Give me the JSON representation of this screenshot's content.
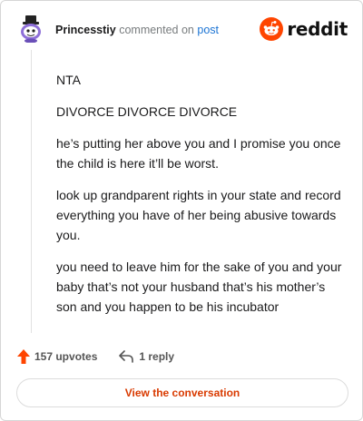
{
  "header": {
    "username": "Princesstiy",
    "commented_text": "commented on",
    "post_link": "post",
    "brand": "reddit",
    "avatar_icon": "snoo-avatar-icon",
    "brand_icon": "reddit-logo-icon",
    "brand_color": "#ff4500"
  },
  "comment": {
    "paragraphs": [
      "NTA",
      "DIVORCE DIVORCE DIVORCE",
      "he’s putting her above you and I promise you once the child is here it’ll be worst.",
      "look up grandparent rights in your state and record everything you have of her being abusive towards you.",
      "you need to leave him for the sake of you and your baby that’s not your husband that’s his mother’s son and you happen to be his incubator"
    ]
  },
  "actions": {
    "upvotes": "157 upvotes",
    "replies": "1 reply",
    "upvote_icon": "upvote-arrow-icon",
    "reply_icon": "reply-arrow-icon",
    "upvote_color": "#ff4500"
  },
  "footer": {
    "view_button": "View the conversation",
    "accent": "#d93a00"
  }
}
